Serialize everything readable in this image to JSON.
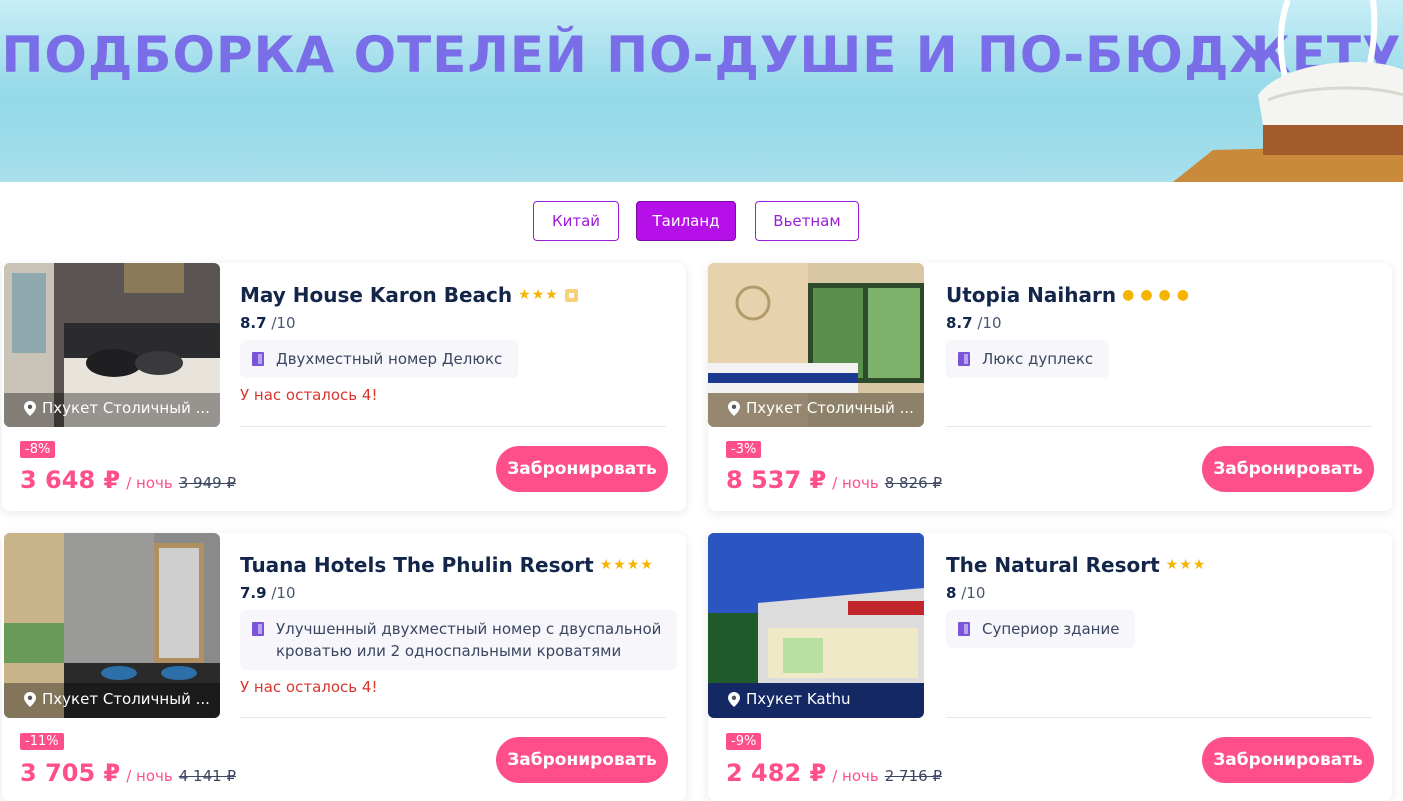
{
  "banner": {
    "title": "ПОДБОРКА ОТЕЛЕЙ ПО-ДУШЕ И ПО-БЮДЖЕТУ"
  },
  "tabs": [
    {
      "label": "Китай"
    },
    {
      "label": "Таиланд",
      "active": true
    },
    {
      "label": "Вьетнам"
    }
  ],
  "hotels": [
    {
      "name": "May House Karon Beach",
      "stars": "★★★",
      "rating": "8.7",
      "rating_max": "/10",
      "room": "Двухместный номер Делюкс",
      "remaining": "У нас осталось 4!",
      "location": "Пхукет Столичный ...",
      "discount": "-8%",
      "price": "3 648 ₽",
      "per_night": "/ ночь",
      "old_price": "3 949 ₽",
      "book_label": "Забронировать"
    },
    {
      "name": "Utopia Naiharn",
      "stars": "●●●●",
      "rating": "8.7",
      "rating_max": "/10",
      "room": "Люкс дуплекс",
      "remaining": "",
      "location": "Пхукет Столичный ...",
      "discount": "-3%",
      "price": "8 537 ₽",
      "per_night": "/ ночь",
      "old_price": "8 826 ₽",
      "book_label": "Забронировать"
    },
    {
      "name": "Tuana Hotels The Phulin Resort",
      "stars": "★★★★",
      "rating": "7.9",
      "rating_max": "/10",
      "room_line1": "Улучшенный двухместный номер с двуспальной",
      "room_line2": "кроватью или 2 односпальными кроватями",
      "remaining": "У нас осталось 4!",
      "location": "Пхукет Столичный ...",
      "discount": "-11%",
      "price": "3 705 ₽",
      "per_night": "/ ночь",
      "old_price": "4 141 ₽",
      "book_label": "Забронировать"
    },
    {
      "name": "The Natural Resort",
      "stars": "★★★",
      "rating": "8",
      "rating_max": "/10",
      "room": "Супериор здание",
      "remaining": "",
      "location": "Пхукет Kathu",
      "discount": "-9%",
      "price": "2 482 ₽",
      "per_night": "/ ночь",
      "old_price": "2 716 ₽",
      "book_label": "Забронировать"
    }
  ],
  "colors": {
    "accent": "#ff4f8b",
    "tab_active": "#b510e8",
    "title": "#7a6ee8"
  }
}
